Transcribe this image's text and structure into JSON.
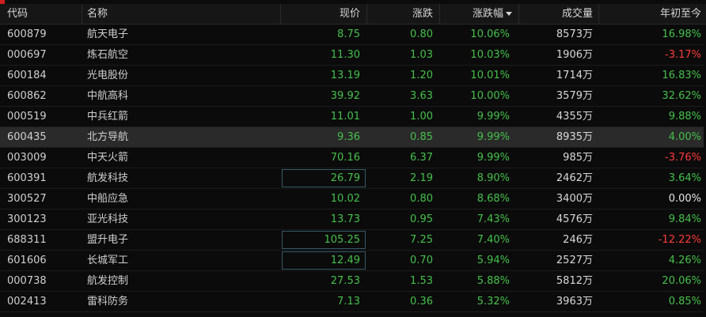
{
  "columns": {
    "code": "代码",
    "name": "名称",
    "price": "现价",
    "change": "涨跌",
    "change_pct": "涨跌幅",
    "volume": "成交量",
    "ytd": "年初至今"
  },
  "sort": {
    "column": "change_pct",
    "direction": "desc",
    "icon": "sort-desc-icon"
  },
  "colors": {
    "up": "#45c04b",
    "down": "#ff3b3b",
    "flat": "#e6e6e6",
    "accent": "#d21e1e"
  },
  "rows": [
    {
      "code": "600879",
      "name": "航天电子",
      "price": "8.75",
      "change": "0.80",
      "pct": "10.06%",
      "volume": "8573万",
      "ytd": "16.98%",
      "ytd_dir": "up"
    },
    {
      "code": "000697",
      "name": "炼石航空",
      "price": "11.30",
      "change": "1.03",
      "pct": "10.03%",
      "volume": "1906万",
      "ytd": "-3.17%",
      "ytd_dir": "down"
    },
    {
      "code": "600184",
      "name": "光电股份",
      "price": "13.19",
      "change": "1.20",
      "pct": "10.01%",
      "volume": "1714万",
      "ytd": "16.83%",
      "ytd_dir": "up"
    },
    {
      "code": "600862",
      "name": "中航高科",
      "price": "39.92",
      "change": "3.63",
      "pct": "10.00%",
      "volume": "3579万",
      "ytd": "32.62%",
      "ytd_dir": "up"
    },
    {
      "code": "000519",
      "name": "中兵红箭",
      "price": "11.01",
      "change": "1.00",
      "pct": "9.99%",
      "volume": "4355万",
      "ytd": "9.88%",
      "ytd_dir": "up"
    },
    {
      "code": "600435",
      "name": "北方导航",
      "price": "9.36",
      "change": "0.85",
      "pct": "9.99%",
      "volume": "8935万",
      "ytd": "4.00%",
      "ytd_dir": "up",
      "selected": true
    },
    {
      "code": "003009",
      "name": "中天火箭",
      "price": "70.16",
      "change": "6.37",
      "pct": "9.99%",
      "volume": "985万",
      "ytd": "-3.76%",
      "ytd_dir": "down"
    },
    {
      "code": "600391",
      "name": "航发科技",
      "price": "26.79",
      "change": "2.19",
      "pct": "8.90%",
      "volume": "2462万",
      "ytd": "3.64%",
      "ytd_dir": "up",
      "price_boxed": true
    },
    {
      "code": "300527",
      "name": "中船应急",
      "price": "10.02",
      "change": "0.80",
      "pct": "8.68%",
      "volume": "3400万",
      "ytd": "0.00%",
      "ytd_dir": "flat"
    },
    {
      "code": "300123",
      "name": "亚光科技",
      "price": "13.73",
      "change": "0.95",
      "pct": "7.43%",
      "volume": "4576万",
      "ytd": "9.84%",
      "ytd_dir": "up"
    },
    {
      "code": "688311",
      "name": "盟升电子",
      "price": "105.25",
      "change": "7.25",
      "pct": "7.40%",
      "volume": "246万",
      "ytd": "-12.22%",
      "ytd_dir": "down",
      "price_boxed": true
    },
    {
      "code": "601606",
      "name": "长城军工",
      "price": "12.49",
      "change": "0.70",
      "pct": "5.94%",
      "volume": "2527万",
      "ytd": "4.26%",
      "ytd_dir": "up",
      "price_boxed": true
    },
    {
      "code": "000738",
      "name": "航发控制",
      "price": "27.53",
      "change": "1.53",
      "pct": "5.88%",
      "volume": "5812万",
      "ytd": "20.06%",
      "ytd_dir": "up"
    },
    {
      "code": "002413",
      "name": "雷科防务",
      "price": "7.13",
      "change": "0.36",
      "pct": "5.32%",
      "volume": "3963万",
      "ytd": "0.85%",
      "ytd_dir": "up"
    }
  ]
}
